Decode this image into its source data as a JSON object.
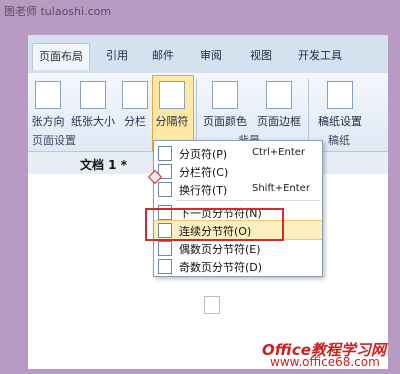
{
  "watermark_top": "图老师 tulaoshi.com",
  "tabs": [
    "页面布局",
    "引用",
    "邮件",
    "审阅",
    "视图",
    "开发工具"
  ],
  "ribbon": {
    "buttons": [
      "张方向",
      "纸张大小",
      "分栏",
      "分隔符",
      "页面颜色",
      "页面边框",
      "稿纸设置"
    ],
    "group_page_setup": "页面设置",
    "group_bg": "背景",
    "group_paper": "稿纸"
  },
  "document": {
    "name": "文档 1 *"
  },
  "menu": {
    "items": [
      {
        "label": "分页符(P)",
        "shortcut": "Ctrl+Enter"
      },
      {
        "label": "分栏符(C)",
        "shortcut": ""
      },
      {
        "label": "换行符(T)",
        "shortcut": "Shift+Enter"
      },
      {
        "label": "下一页分节符(N)",
        "shortcut": ""
      },
      {
        "label": "连续分节符(O)",
        "shortcut": ""
      },
      {
        "label": "偶数页分节符(E)",
        "shortcut": ""
      },
      {
        "label": "奇数页分节符(D)",
        "shortcut": ""
      }
    ]
  },
  "watermark_bottom": "Office教程学习网",
  "watermark_url": "www.office68.com"
}
